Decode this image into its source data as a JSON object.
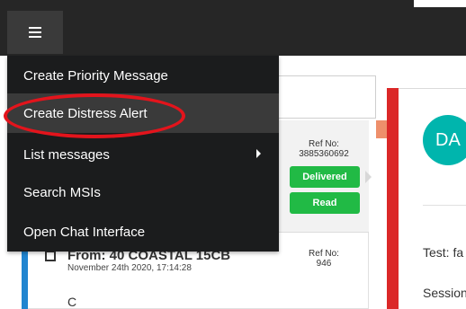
{
  "menu": {
    "items": [
      {
        "label": "Create Priority Message"
      },
      {
        "label": "Create Distress Alert"
      },
      {
        "label": "List messages"
      },
      {
        "label": "Search MSIs"
      },
      {
        "label": "Open Chat Interface"
      }
    ]
  },
  "messages": [
    {
      "ref_label": "Ref No:",
      "ref_no": "3885360692",
      "status": [
        "Delivered",
        "Read"
      ]
    },
    {
      "ref_label": "Ref No:",
      "ref_no": "946",
      "from": "From: 40 COASTAL 15CB",
      "date": "November 24th 2020, 17:14:28",
      "preview": "C"
    }
  ],
  "detail": {
    "avatar_initials": "DA",
    "line1": "Test: fa",
    "line2": "Session"
  },
  "colors": {
    "topbar": "#262626",
    "menu_bg": "#1b1c1d",
    "menu_hover": "#3a3a3a",
    "badge_green": "#21ba45",
    "accent_blue": "#2185d0",
    "alert_red": "#db2828",
    "avatar_teal": "#00b5ad",
    "annotation_red": "#e3141c"
  }
}
